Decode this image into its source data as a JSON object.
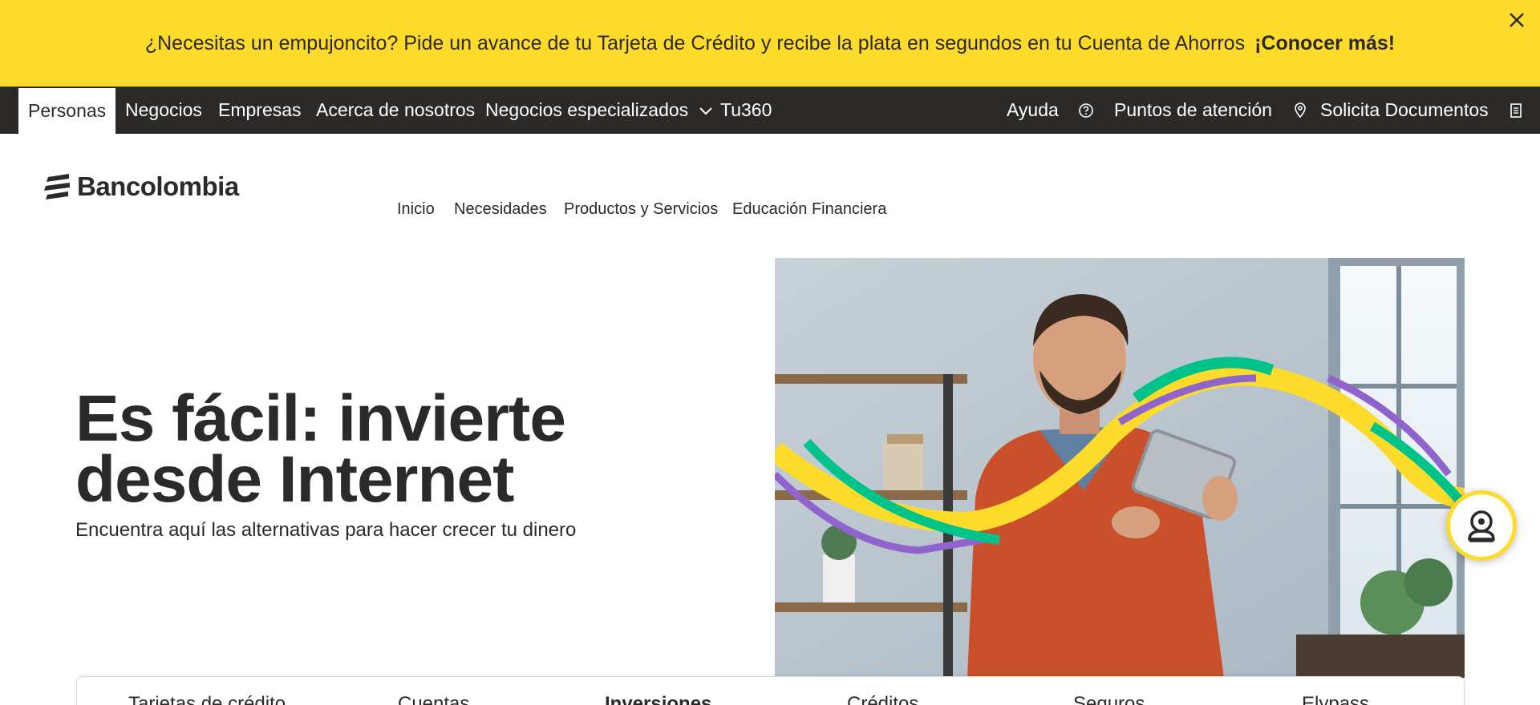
{
  "announcement": {
    "text": "¿Necesitas un empujoncito? Pide un avance de tu Tarjeta de Crédito y recibe la plata en segundos en tu Cuenta de Ahorros",
    "link_label": "¡Conocer más!"
  },
  "top_nav": {
    "segments": [
      {
        "label": "Personas",
        "active": true
      },
      {
        "label": "Negocios"
      },
      {
        "label": "Empresas"
      },
      {
        "label": "Acerca de nosotros"
      },
      {
        "label": "Negocios especializados",
        "icon": "chevron-down-icon"
      },
      {
        "label": "Tu360"
      }
    ],
    "utility": [
      {
        "label": "Ayuda",
        "icon": "help-circle-icon"
      },
      {
        "label": "Puntos de atención",
        "icon": "location-pin-icon"
      },
      {
        "label": "Solicita Documentos",
        "icon": "document-icon"
      }
    ]
  },
  "brand": {
    "name": "Bancolombia",
    "accent": "#fddb2b",
    "dark": "#2c2a29",
    "green": "#00c389",
    "purple": "#9063cd"
  },
  "main_nav": [
    "Inicio",
    "Necesidades",
    "Productos y Servicios",
    "Educación Financiera"
  ],
  "hero": {
    "title_line1": "Es fácil: invierte",
    "title_line2": "desde Internet",
    "subtitle": "Encuentra aquí las alternativas para hacer crecer tu dinero"
  },
  "chat": {
    "icon": "virtual-assistant-icon"
  },
  "product_tabs": [
    {
      "label": "Tarjetas de crédito"
    },
    {
      "label": "Cuentas"
    },
    {
      "label": "Inversiones",
      "active": true
    },
    {
      "label": "Créditos"
    },
    {
      "label": "Seguros"
    },
    {
      "label": "Elypass"
    }
  ]
}
